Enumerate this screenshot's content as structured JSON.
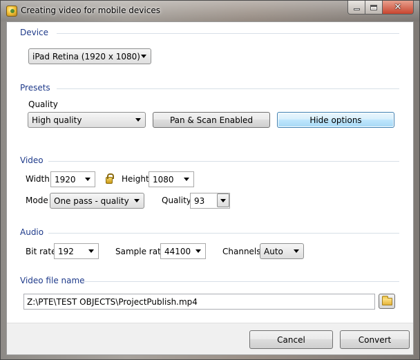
{
  "window": {
    "title": "Creating video for mobile devices"
  },
  "device": {
    "section": "Device",
    "selected": "iPad Retina (1920 x 1080)"
  },
  "presets": {
    "section": "Presets",
    "quality_label": "Quality",
    "quality_selected": "High quality",
    "pan_scan_label": "Pan & Scan Enabled",
    "hide_options_label": "Hide options"
  },
  "video": {
    "section": "Video",
    "width_label": "Width",
    "width_value": "1920",
    "height_label": "Height",
    "height_value": "1080",
    "mode_label": "Mode",
    "mode_selected": "One pass - quality",
    "quality_label": "Quality",
    "quality_value": "93"
  },
  "audio": {
    "section": "Audio",
    "bitrate_label": "Bit rate",
    "bitrate_value": "192",
    "samplerate_label": "Sample rate",
    "samplerate_value": "44100",
    "channels_label": "Channels",
    "channels_selected": "Auto"
  },
  "file": {
    "section": "Video file name",
    "path": "Z:\\PTE\\TEST OBJECTS\\ProjectPublish.mp4"
  },
  "footer": {
    "cancel_label": "Cancel",
    "convert_label": "Convert"
  },
  "colors": {
    "section_label": "#1e3a8a",
    "focus_button_border": "#3c7fb1"
  },
  "icons": {
    "app": "app-icon",
    "lock": "lock-icon",
    "folder": "folder-icon",
    "minimize": "minimize-icon",
    "maximize": "maximize-icon",
    "close": "close-icon"
  }
}
